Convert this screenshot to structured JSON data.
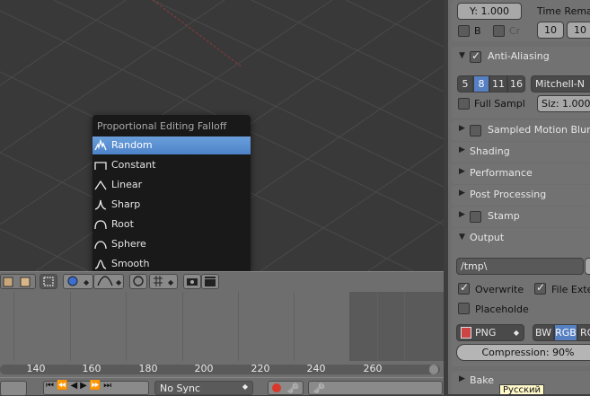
{
  "viewport": {
    "falloff_menu": {
      "title": "Proportional Editing Falloff",
      "items": [
        {
          "label": "Random",
          "icon": "random-falloff-icon",
          "active": true
        },
        {
          "label": "Constant",
          "icon": "constant-falloff-icon",
          "active": false
        },
        {
          "label": "Linear",
          "icon": "linear-falloff-icon",
          "active": false
        },
        {
          "label": "Sharp",
          "icon": "sharp-falloff-icon",
          "active": false
        },
        {
          "label": "Root",
          "icon": "root-falloff-icon",
          "active": false
        },
        {
          "label": "Sphere",
          "icon": "sphere-falloff-icon",
          "active": false
        },
        {
          "label": "Smooth",
          "icon": "smooth-falloff-icon",
          "active": false
        }
      ]
    }
  },
  "timeline": {
    "ruler": [
      "140",
      "160",
      "180",
      "200",
      "220",
      "240",
      "260"
    ],
    "sync": "No Sync"
  },
  "properties": {
    "top": {
      "y_field": "Y: 1.000",
      "time_remap": "Time Remap",
      "b_label": "B",
      "cr_label": "Cr",
      "remap_old": "10",
      "remap_new": "10"
    },
    "anti_aliasing": {
      "label": "Anti-Aliasing",
      "samples": [
        "5",
        "8",
        "11",
        "16"
      ],
      "selected_sample": "8",
      "filter": "Mitchell-N",
      "full_sample": "Full Sampl",
      "size": "Siz: 1.000"
    },
    "panels": [
      "Sampled Motion Blur",
      "Shading",
      "Performance",
      "Post Processing",
      "Stamp"
    ],
    "output": {
      "label": "Output",
      "path": "/tmp\\",
      "overwrite": "Overwrite",
      "file_ext": "File Exte",
      "placeholders": "Placeholde",
      "format": "PNG",
      "color_modes": [
        "BW",
        "RGB",
        "RG"
      ],
      "color_selected": "RGB",
      "compression": "Compression: 90%"
    },
    "bake": "Bake",
    "tooltip": "Русский"
  }
}
